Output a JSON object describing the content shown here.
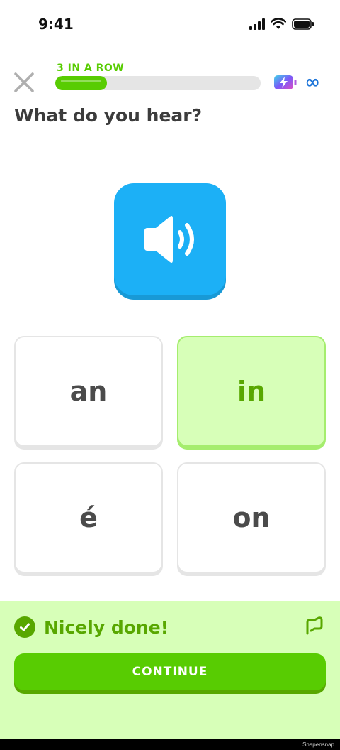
{
  "status_bar": {
    "time": "9:41"
  },
  "header": {
    "streak_label": "3 IN A ROW",
    "progress": 0.25,
    "energy_value": "∞"
  },
  "prompt": {
    "question": "What do you hear?"
  },
  "choices": [
    {
      "label": "an",
      "selected": false
    },
    {
      "label": "in",
      "selected": true
    },
    {
      "label": "é",
      "selected": false
    },
    {
      "label": "on",
      "selected": false
    }
  ],
  "feedback": {
    "title": "Nicely done!",
    "continue_label": "CONTINUE"
  },
  "watermark": "Snapensnap",
  "colors": {
    "brand_green": "#58cc02",
    "dark_green": "#58a700",
    "light_green": "#d7ffb8",
    "speaker_blue": "#1cb0f6",
    "infinity_blue": "#1c74d9"
  }
}
